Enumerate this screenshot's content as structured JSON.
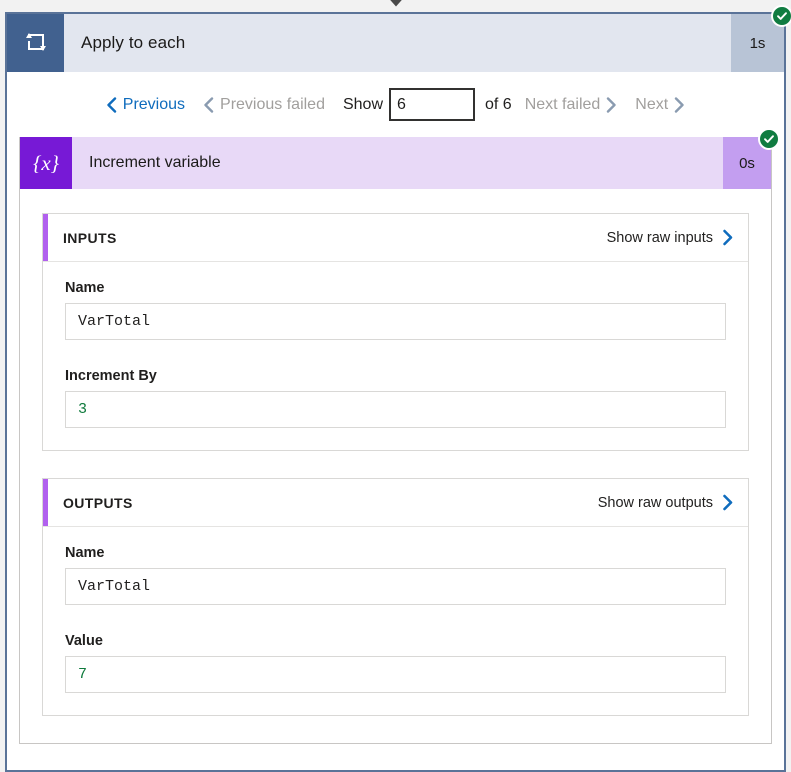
{
  "connector": {
    "icon": "down-arrow-icon"
  },
  "scope": {
    "icon": "loop-apply-to-each-icon",
    "title": "Apply to each",
    "duration": "1s",
    "status": "succeeded",
    "status_icon": "check-circle-icon",
    "status_color": "#107c41",
    "header_bg": "#e2e6ef",
    "icon_bg": "#41618f",
    "duration_bg": "#b8c4d6",
    "border_color": "#5a7398"
  },
  "pager": {
    "previous_label": "Previous",
    "previous_enabled": true,
    "previous_failed_label": "Previous failed",
    "previous_failed_enabled": false,
    "show_label": "Show",
    "show_value": "6",
    "show_placeholder": "",
    "of_label": "of 6",
    "total": "6",
    "next_failed_label": "Next failed",
    "next_failed_enabled": false,
    "next_label": "Next",
    "next_enabled": false,
    "enabled_color": "#0f6cbd",
    "disabled_color": "#a19f9d",
    "chevron_left_icon": "chevron-left-icon",
    "chevron_right_icon": "chevron-right-icon"
  },
  "action": {
    "icon": "{x}",
    "icon_name": "variable-braces-icon",
    "title": "Increment variable",
    "duration": "0s",
    "status": "succeeded",
    "status_icon": "check-circle-icon",
    "header_bg": "#e8d9f7",
    "icon_bg": "#7719d6",
    "duration_bg": "#c39ef0",
    "accent_color": "#b160ee"
  },
  "inputs": {
    "title": "INPUTS",
    "raw_link": "Show raw inputs",
    "raw_link_icon": "chevron-right-icon",
    "fields": [
      {
        "label": "Name",
        "value": "VarTotal",
        "type": "string"
      },
      {
        "label": "Increment By",
        "value": "3",
        "type": "number"
      }
    ]
  },
  "outputs": {
    "title": "OUTPUTS",
    "raw_link": "Show raw outputs",
    "raw_link_icon": "chevron-right-icon",
    "fields": [
      {
        "label": "Name",
        "value": "VarTotal",
        "type": "string"
      },
      {
        "label": "Value",
        "value": "7",
        "type": "number"
      }
    ]
  }
}
